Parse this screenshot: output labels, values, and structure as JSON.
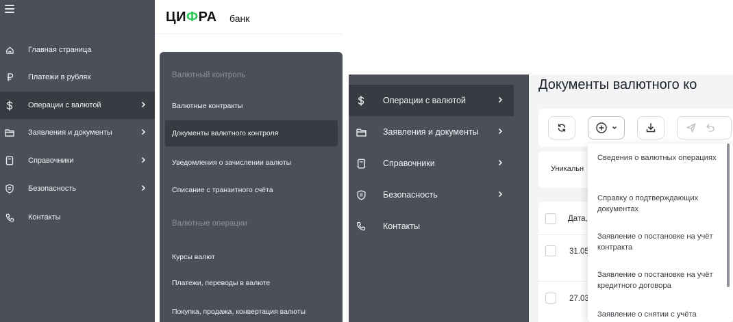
{
  "logo": {
    "brand": "ЦИФРА",
    "sub": "банк"
  },
  "sidebar1": {
    "items": [
      {
        "label": "Главная страница",
        "icon": "home-icon"
      },
      {
        "label": "Платежи в рублях",
        "icon": "ruble-icon"
      },
      {
        "label": "Операции с валютой",
        "icon": "dollar-icon"
      },
      {
        "label": "Заявления и документы",
        "icon": "folder-icon"
      },
      {
        "label": "Справочники",
        "icon": "book-icon"
      },
      {
        "label": "Безопасность",
        "icon": "shield-icon"
      },
      {
        "label": "Контакты",
        "icon": "phone-icon"
      }
    ]
  },
  "submenu1": {
    "section1": "Валютный контроль",
    "items1": [
      "Валютные контракты",
      "Документы валютного контроля",
      "Уведомления о зачислении валюты",
      "Списание с транзитного счёта"
    ],
    "section2": "Валютные операции",
    "items2": [
      "Курсы валют",
      "Платежи, переводы в валюте",
      "Покупка, продажа, конвертация валюты"
    ]
  },
  "sidebar2": {
    "items": [
      {
        "label": "Операции с валютой",
        "icon": "dollar-icon"
      },
      {
        "label": "Заявления и документы",
        "icon": "folder-icon"
      },
      {
        "label": "Справочники",
        "icon": "book-icon"
      },
      {
        "label": "Безопасность",
        "icon": "shield-icon"
      },
      {
        "label": "Контакты",
        "icon": "phone-icon"
      }
    ]
  },
  "main2": {
    "title": "Документы валютного ко",
    "filter_text": "Уникальн",
    "table": {
      "header": "Дата,",
      "rows": [
        "31.05",
        "27.03"
      ]
    }
  },
  "create_menu": {
    "items": [
      "Сведения о валютных операциях",
      "Справку о подтверждающих документах",
      "Заявление о постановке на учёт контракта",
      "Заявление о постановке на учёт кредитного договора",
      "Заявление о снятии с учёта"
    ]
  },
  "colors": {
    "sidebar_bg": "#4a4f58",
    "sidebar_active": "#373b42",
    "brand_accent": "#2fc85a",
    "content_bg": "#f3f4f6"
  }
}
